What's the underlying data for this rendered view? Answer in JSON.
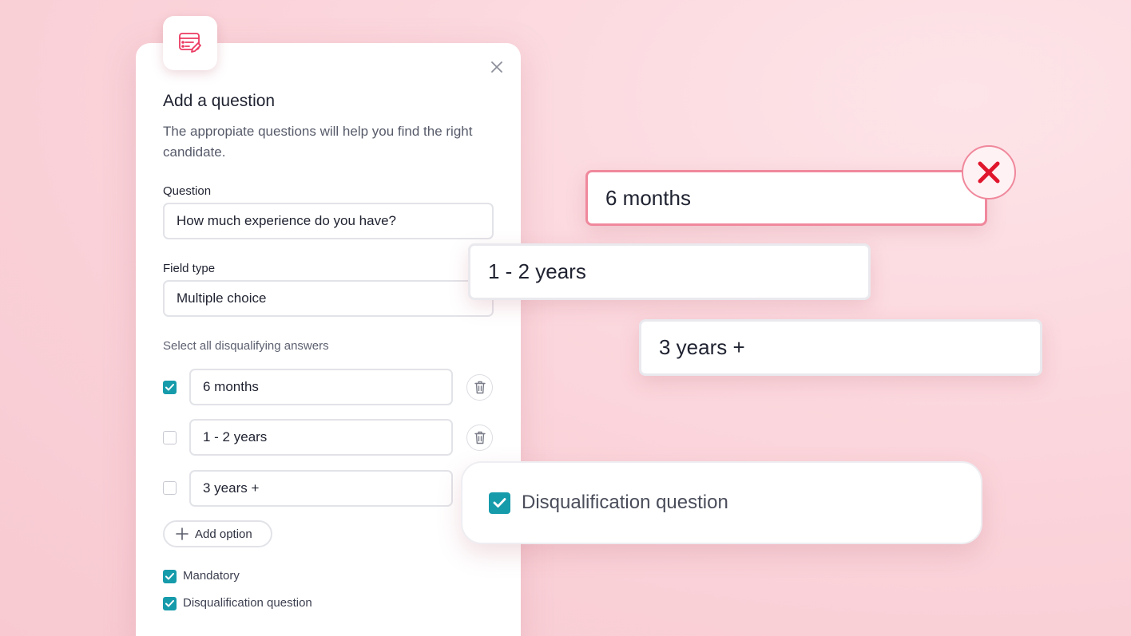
{
  "modal": {
    "title": "Add a question",
    "description": "The appropiate questions will help you find the right candidate.",
    "question_label": "Question",
    "question_value": "How much experience do you have?",
    "field_type_label": "Field type",
    "field_type_value": "Multiple choice",
    "disqualify_label": "Select all disqualifying answers",
    "options": [
      {
        "label": "6 months",
        "checked": true
      },
      {
        "label": "1 - 2 years",
        "checked": false
      },
      {
        "label": "3 years +",
        "checked": false
      }
    ],
    "add_option_label": "Add option",
    "mandatory_label": "Mandatory",
    "mandatory_checked": true,
    "disqualification_label": "Disqualification question",
    "disqualification_checked": true
  },
  "floating": {
    "card_error": "6 months",
    "card_2": "1 - 2 years",
    "card_3": "3 years +",
    "disqualification_card": "Disqualification question"
  },
  "colors": {
    "accent": "#169bab",
    "error": "#e0162d",
    "brand_icon": "#ec3b63",
    "background": "#fbd6dc"
  },
  "icons": {
    "badge": "form-edit-icon",
    "close": "close-icon",
    "trash": "trash-icon",
    "add": "plus-icon",
    "error": "x-mark-icon",
    "check": "check-icon"
  }
}
